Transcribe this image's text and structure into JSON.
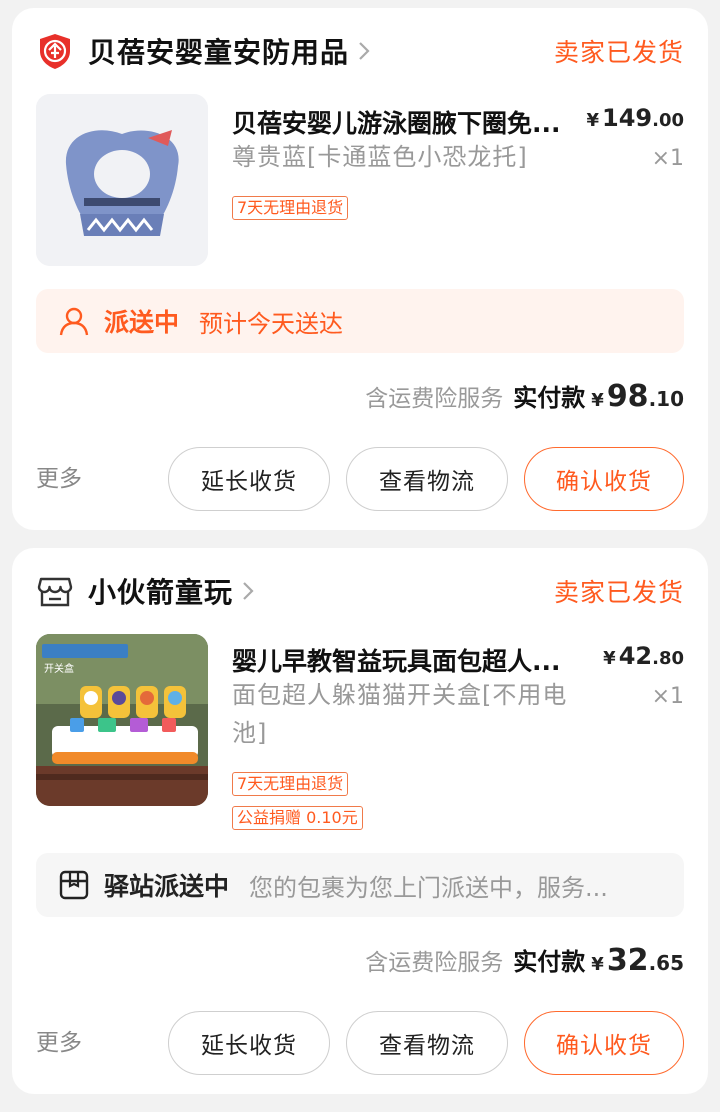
{
  "orders": [
    {
      "shop": {
        "name": "贝蓓安婴童安防用品",
        "logo_icon": "enterprise-shield-icon"
      },
      "status": "卖家已发货",
      "item": {
        "title": "贝蓓安婴儿游泳圈腋下圈免...",
        "price_symbol": "¥",
        "price_int": "149",
        "price_dec": ".00",
        "spec": "尊贵蓝[卡通蓝色小恐龙托]",
        "qty": "×1",
        "tags": [
          "7天无理由退货"
        ]
      },
      "delivery": {
        "icon": "courier-person-icon",
        "status": "派送中",
        "desc": "预计今天送达"
      },
      "payment": {
        "service": "含运费险服务",
        "label": "实付款",
        "symbol": "¥",
        "int": "98",
        "dec": ".10"
      },
      "actions": {
        "more": "更多",
        "extend": "延长收货",
        "logistics": "查看物流",
        "confirm": "确认收货"
      }
    },
    {
      "shop": {
        "name": "小伙箭童玩",
        "logo_icon": "store-icon"
      },
      "status": "卖家已发货",
      "item": {
        "title": "婴儿早教智益玩具面包超人...",
        "price_symbol": "¥",
        "price_int": "42",
        "price_dec": ".80",
        "spec": "面包超人躲猫猫开关盒[不用电池]",
        "qty": "×1",
        "tags": [
          "7天无理由退货",
          "公益捐赠 0.10元"
        ],
        "thumb_text": "开关盒"
      },
      "delivery": {
        "icon": "parcel-station-icon",
        "status": "驿站派送中",
        "desc": "您的包裹为您上门派送中，服务..."
      },
      "payment": {
        "service": "含运费险服务",
        "label": "实付款",
        "symbol": "¥",
        "int": "32",
        "dec": ".65"
      },
      "actions": {
        "more": "更多",
        "extend": "延长收货",
        "logistics": "查看物流",
        "confirm": "确认收货"
      }
    }
  ],
  "colors": {
    "accent": "#ff5a1f",
    "accent_bg": "#fff3ee",
    "muted": "#999999",
    "page_bg": "#f2f2f2"
  }
}
